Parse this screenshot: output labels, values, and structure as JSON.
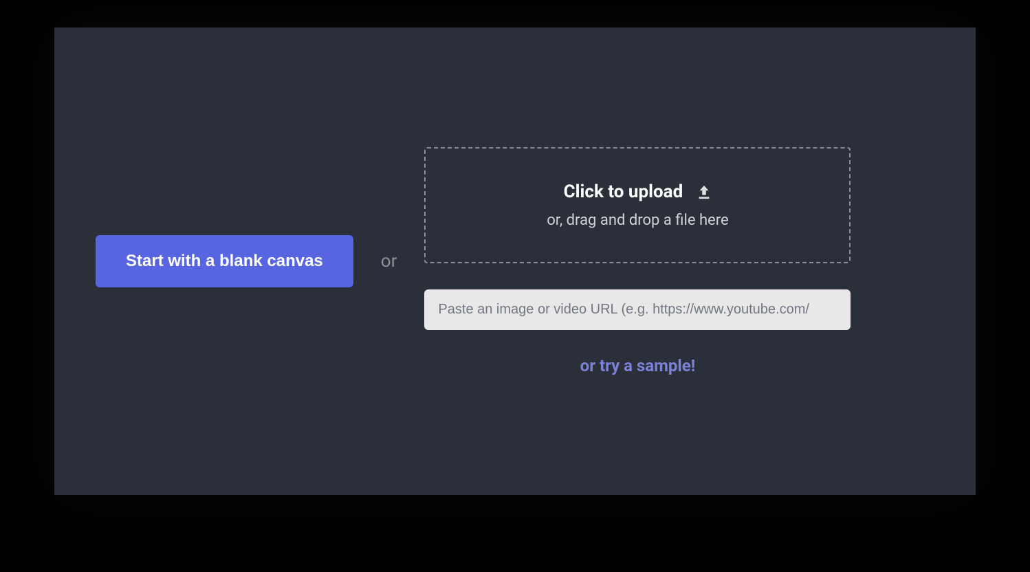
{
  "start_button_label": "Start with a blank canvas",
  "or_separator": "or",
  "drop_zone": {
    "title": "Click to upload",
    "subtitle": "or, drag and drop a file here"
  },
  "url_input": {
    "placeholder": "Paste an image or video URL (e.g. https://www.youtube.com/"
  },
  "sample_link_label": "or try a sample!"
}
